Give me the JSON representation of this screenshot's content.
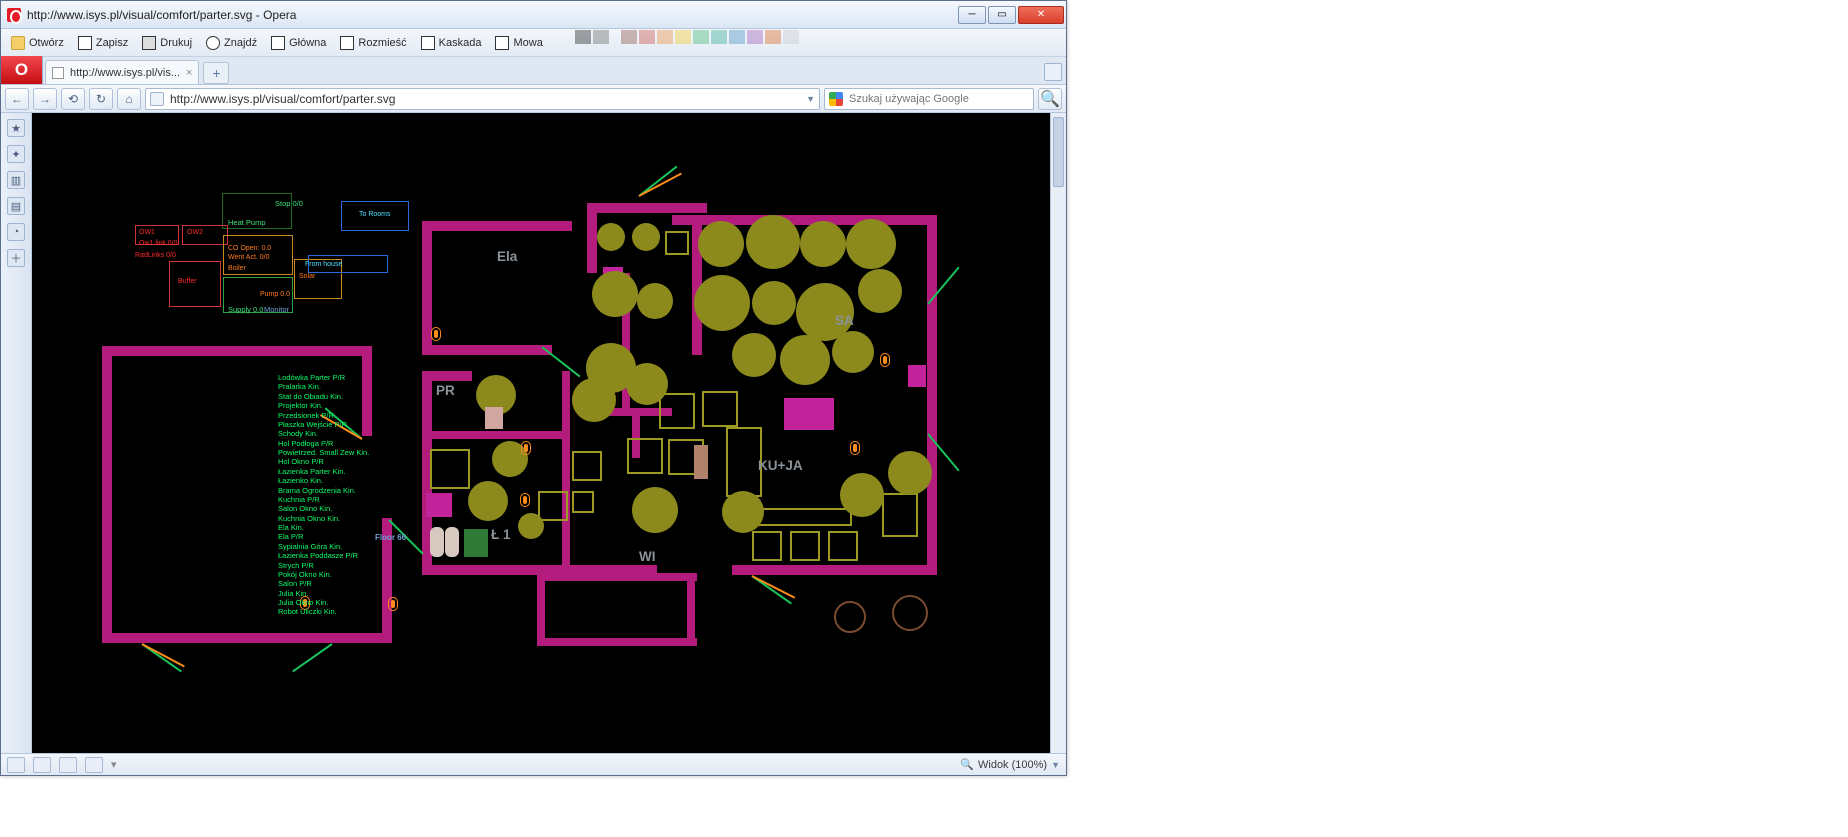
{
  "window": {
    "title": "http://www.isys.pl/visual/comfort/parter.svg - Opera"
  },
  "menubar": {
    "open": "Otwórz",
    "save": "Zapisz",
    "print": "Drukuj",
    "find": "Znajdź",
    "home": "Główna",
    "resize": "Rozmieść",
    "cascade": "Kaskada",
    "speech": "Mowa"
  },
  "tab": {
    "label": "http://www.isys.pl/vis..."
  },
  "address": {
    "url": "http://www.isys.pl/visual/comfort/parter.svg"
  },
  "search": {
    "placeholder": "Szukaj używając Google"
  },
  "status": {
    "zoom_label": "Widok (100%)"
  },
  "floorplan": {
    "rooms": {
      "ela": "Ela",
      "pr": "PR",
      "sa": "SA",
      "kuja": "KU+JA",
      "wi": "WI",
      "l1": "Ł 1"
    },
    "legend_floor": "Floor 66",
    "panel": {
      "to_rooms": "To Rooms",
      "from_house": "From house",
      "buffer": "Buffer",
      "solar": "Solar",
      "boiler": "Boiler",
      "hp_status": "Stop 0/0",
      "hp_name": "Heat Pump",
      "co_open": "CO Open: 0.0",
      "went_act": "Went Act. 0/0",
      "pump": "Pump 0.0",
      "supply": "Supply 0.0",
      "monitor": "Monitor",
      "ow1": "OW1",
      "ow2": "OW2",
      "owlink": "Ow1 link 0/0",
      "radlinks": "RadLinks 0/0"
    },
    "legend": [
      "Lodówka Parter P/R",
      "Pralarka Kin.",
      "Stat do Obiadu Kin.",
      "Projektor Kin.",
      "Przedsionek P/R",
      "Płaszka Wejście P/R",
      "Schody Kin.",
      "Hol Podłoga P/R",
      "Powietrzed. Small Zew Kin.",
      "Hol Okno P/R",
      "Łazienka Parter Kin.",
      "Łazienko Kin.",
      "Brama Ogrodzenia Kin.",
      "Kuchnia P/R",
      "Salon Okno Kin.",
      "Kuchnia Okno Kin.",
      "Ela Kin.",
      "Ela P/R",
      "Sypialnia Góra Kin.",
      "Łazienka Poddasze P/R",
      "Strych P/R",
      "Pokój Okno Kin.",
      "Salon P/R",
      "Julia Kin.",
      "Julia Okno Kin.",
      "Robot Uliczki Kin."
    ]
  }
}
